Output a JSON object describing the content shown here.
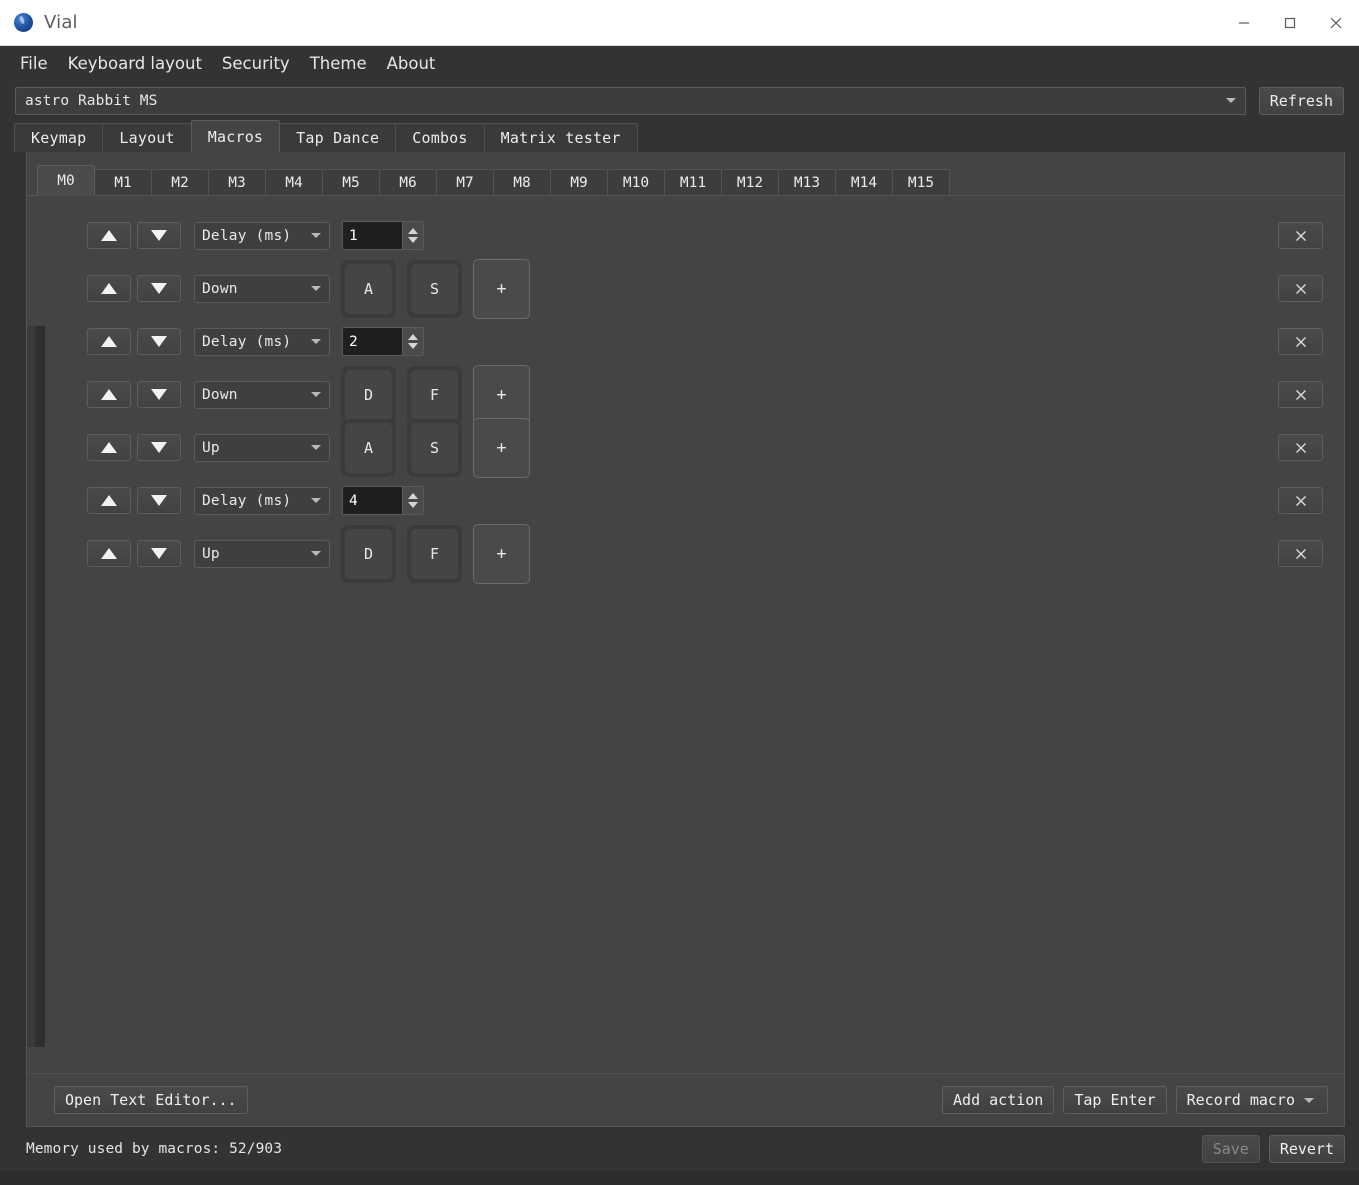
{
  "window": {
    "title": "Vial",
    "icon": "vial-app-icon",
    "controls": {
      "minimize": "minimize-icon",
      "maximize": "maximize-icon",
      "close": "close-icon"
    }
  },
  "menubar": {
    "items": [
      {
        "label": "File"
      },
      {
        "label": "Keyboard layout"
      },
      {
        "label": "Security"
      },
      {
        "label": "Theme"
      },
      {
        "label": "About"
      }
    ]
  },
  "keyboard_selector": {
    "value": "astro Rabbit MS",
    "dropdown_icon": "chevron-down-icon",
    "refresh_label": "Refresh"
  },
  "main_tabs": {
    "active": "Macros",
    "items": [
      {
        "label": "Keymap"
      },
      {
        "label": "Layout"
      },
      {
        "label": "Macros"
      },
      {
        "label": "Tap Dance"
      },
      {
        "label": "Combos"
      },
      {
        "label": "Matrix tester"
      }
    ]
  },
  "macro_tabs": {
    "active": "M0",
    "items": [
      {
        "label": "M0"
      },
      {
        "label": "M1"
      },
      {
        "label": "M2"
      },
      {
        "label": "M3"
      },
      {
        "label": "M4"
      },
      {
        "label": "M5"
      },
      {
        "label": "M6"
      },
      {
        "label": "M7"
      },
      {
        "label": "M8"
      },
      {
        "label": "M9"
      },
      {
        "label": "M10"
      },
      {
        "label": "M11"
      },
      {
        "label": "M12"
      },
      {
        "label": "M13"
      },
      {
        "label": "M14"
      },
      {
        "label": "M15"
      }
    ]
  },
  "action_row_controls": {
    "move_up_icon": "triangle-up-icon",
    "move_down_icon": "triangle-down-icon",
    "delete_icon": "close-x-icon",
    "add_key_label": "+",
    "combo_caret_icon": "chevron-down-icon",
    "spin_up_icon": "spin-up-arrow-icon",
    "spin_down_icon": "spin-down-arrow-icon"
  },
  "actions": [
    {
      "type": "delay",
      "action": "Delay (ms)",
      "value": "1"
    },
    {
      "type": "keys",
      "action": "Down",
      "keys": [
        "A",
        "S"
      ]
    },
    {
      "type": "delay",
      "action": "Delay (ms)",
      "value": "2"
    },
    {
      "type": "keys",
      "action": "Down",
      "keys": [
        "D",
        "F"
      ]
    },
    {
      "type": "keys",
      "action": "Up",
      "keys": [
        "A",
        "S"
      ]
    },
    {
      "type": "delay",
      "action": "Delay (ms)",
      "value": "4"
    },
    {
      "type": "keys",
      "action": "Up",
      "keys": [
        "D",
        "F"
      ]
    }
  ],
  "bottom_bar": {
    "open_text_editor": "Open Text Editor...",
    "add_action": "Add action",
    "tap_enter": "Tap Enter",
    "record_macro": "Record macro",
    "record_macro_caret": "chevron-down-icon"
  },
  "status_bar": {
    "memory_text": "Memory used by macros: 52/903",
    "save_label": "Save",
    "save_enabled": false,
    "revert_label": "Revert"
  },
  "colors": {
    "window_bg": "#333333",
    "panel_bg": "#444444",
    "titlebar_bg": "#ffffff",
    "text": "#e9e9e9",
    "border": "#5a5a5a",
    "spin_field_bg": "#1f1f1f"
  }
}
